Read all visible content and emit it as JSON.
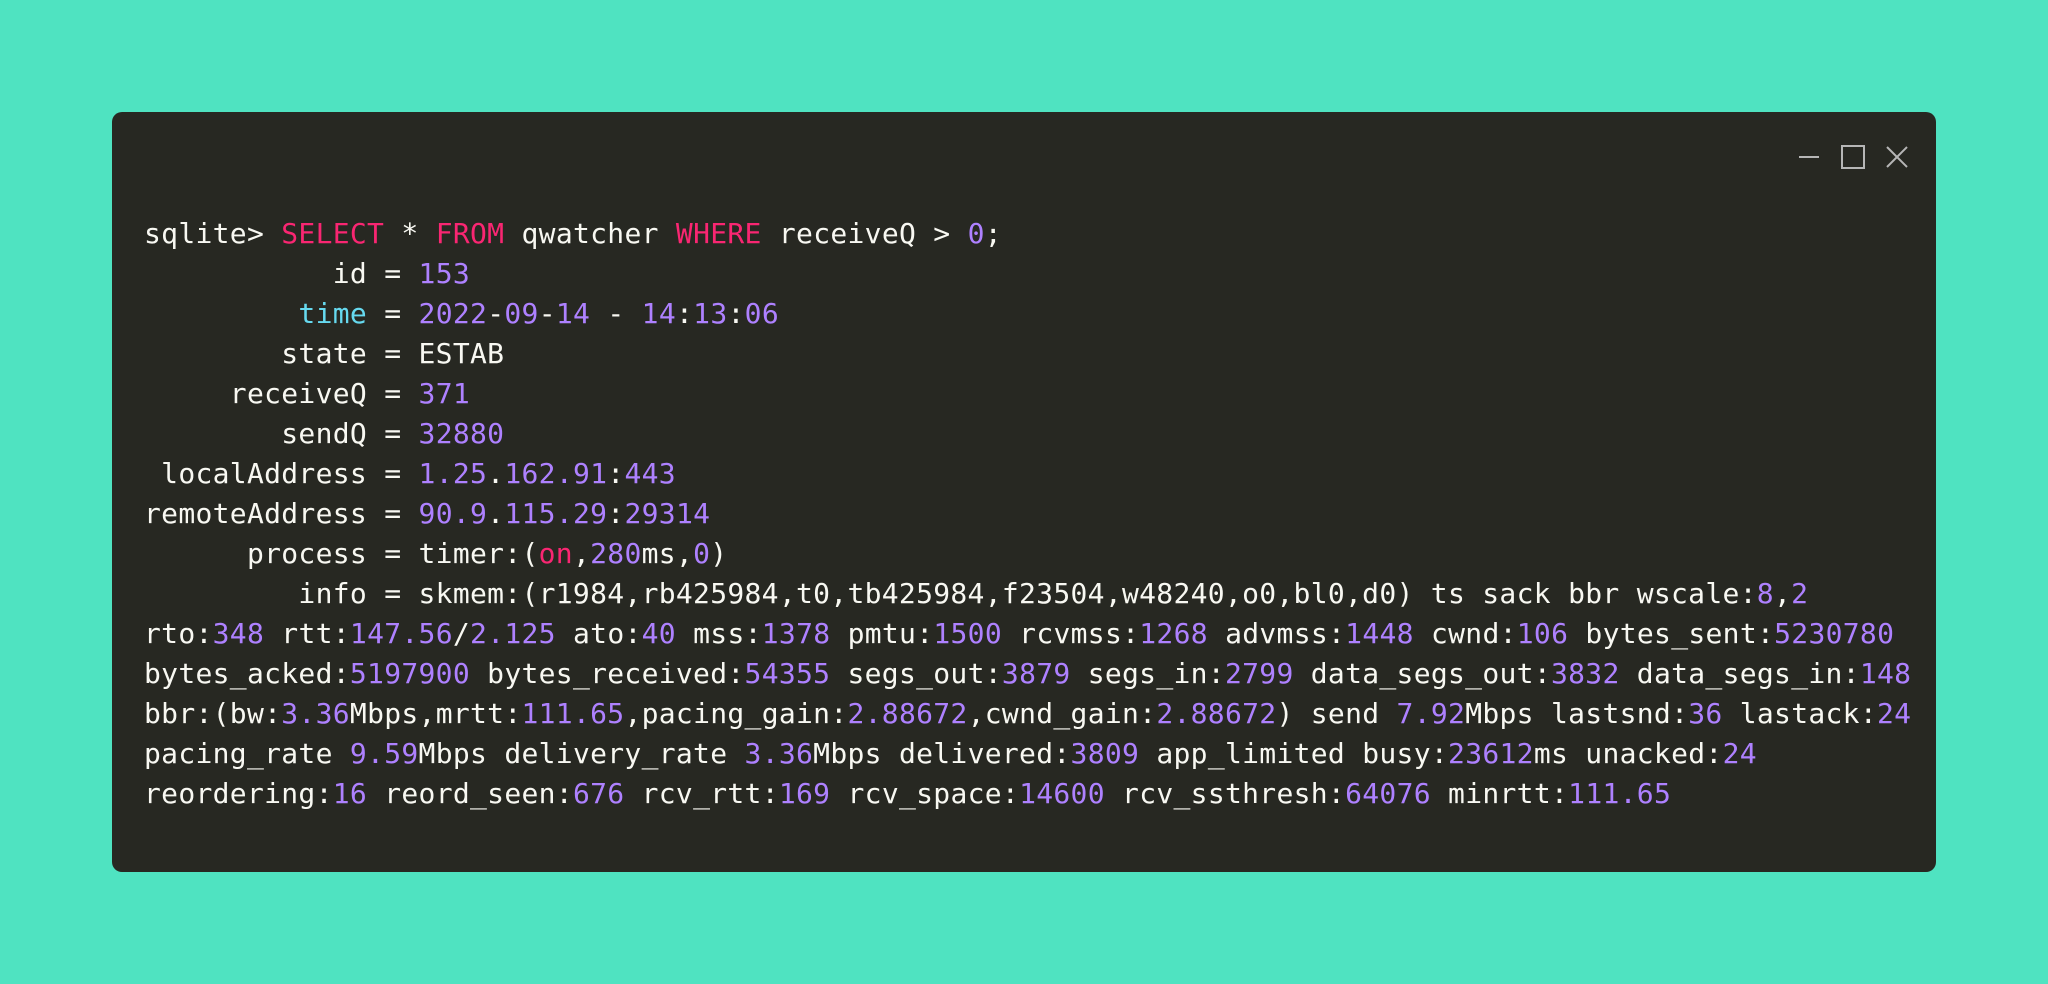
{
  "colors": {
    "background": "#4fe3c1",
    "window": "#272822",
    "text": "#f8f8f2",
    "keyword": "#f92672",
    "number": "#ae81ff",
    "highlight": "#66d9ef",
    "controls": "#b6b6b6"
  },
  "window_controls": [
    {
      "name": "minimize-icon"
    },
    {
      "name": "maximize-icon"
    },
    {
      "name": "close-icon"
    }
  ],
  "terminal_lines": [
    [
      [
        "t",
        "sqlite> "
      ],
      [
        "k",
        "SELECT"
      ],
      [
        "t",
        " * "
      ],
      [
        "k",
        "FROM"
      ],
      [
        "t",
        " qwatcher "
      ],
      [
        "k",
        "WHERE"
      ],
      [
        "t",
        " receiveQ > "
      ],
      [
        "n",
        "0"
      ],
      [
        "t",
        ";"
      ]
    ],
    [
      [
        "t",
        "           id = "
      ],
      [
        "n",
        "153"
      ]
    ],
    [
      [
        "t",
        "         "
      ],
      [
        "c",
        "time"
      ],
      [
        "t",
        " = "
      ],
      [
        "n",
        "2022"
      ],
      [
        "t",
        "-"
      ],
      [
        "n",
        "09"
      ],
      [
        "t",
        "-"
      ],
      [
        "n",
        "14"
      ],
      [
        "t",
        " - "
      ],
      [
        "n",
        "14"
      ],
      [
        "t",
        ":"
      ],
      [
        "n",
        "13"
      ],
      [
        "t",
        ":"
      ],
      [
        "n",
        "06"
      ]
    ],
    [
      [
        "t",
        "        state = ESTAB"
      ]
    ],
    [
      [
        "t",
        "     receiveQ = "
      ],
      [
        "n",
        "371"
      ]
    ],
    [
      [
        "t",
        "        sendQ = "
      ],
      [
        "n",
        "32880"
      ]
    ],
    [
      [
        "t",
        " localAddress = "
      ],
      [
        "n",
        "1.25"
      ],
      [
        "t",
        "."
      ],
      [
        "n",
        "162.91"
      ],
      [
        "t",
        ":"
      ],
      [
        "n",
        "443"
      ]
    ],
    [
      [
        "t",
        "remoteAddress = "
      ],
      [
        "n",
        "90.9"
      ],
      [
        "t",
        "."
      ],
      [
        "n",
        "115.29"
      ],
      [
        "t",
        ":"
      ],
      [
        "n",
        "29314"
      ]
    ],
    [
      [
        "t",
        "      process = timer:("
      ],
      [
        "k",
        "on"
      ],
      [
        "t",
        ","
      ],
      [
        "n",
        "280"
      ],
      [
        "t",
        "ms,"
      ],
      [
        "n",
        "0"
      ],
      [
        "t",
        ")"
      ]
    ],
    [
      [
        "t",
        "         info = skmem:(r1984,rb425984,t0,tb425984,f23504,w48240,o0,bl0,d0) ts sack bbr wscale:"
      ],
      [
        "n",
        "8"
      ],
      [
        "t",
        ","
      ],
      [
        "n",
        "2"
      ]
    ],
    [
      [
        "t",
        "rto:"
      ],
      [
        "n",
        "348"
      ],
      [
        "t",
        " rtt:"
      ],
      [
        "n",
        "147.56"
      ],
      [
        "t",
        "/"
      ],
      [
        "n",
        "2.125"
      ],
      [
        "t",
        " ato:"
      ],
      [
        "n",
        "40"
      ],
      [
        "t",
        " mss:"
      ],
      [
        "n",
        "1378"
      ],
      [
        "t",
        " pmtu:"
      ],
      [
        "n",
        "1500"
      ],
      [
        "t",
        " rcvmss:"
      ],
      [
        "n",
        "1268"
      ],
      [
        "t",
        " advmss:"
      ],
      [
        "n",
        "1448"
      ],
      [
        "t",
        " cwnd:"
      ],
      [
        "n",
        "106"
      ],
      [
        "t",
        " bytes_sent:"
      ],
      [
        "n",
        "5230780"
      ]
    ],
    [
      [
        "t",
        "bytes_acked:"
      ],
      [
        "n",
        "5197900"
      ],
      [
        "t",
        " bytes_received:"
      ],
      [
        "n",
        "54355"
      ],
      [
        "t",
        " segs_out:"
      ],
      [
        "n",
        "3879"
      ],
      [
        "t",
        " segs_in:"
      ],
      [
        "n",
        "2799"
      ],
      [
        "t",
        " data_segs_out:"
      ],
      [
        "n",
        "3832"
      ],
      [
        "t",
        " data_segs_in:"
      ],
      [
        "n",
        "148"
      ]
    ],
    [
      [
        "t",
        "bbr:(bw:"
      ],
      [
        "n",
        "3.36"
      ],
      [
        "t",
        "Mbps,mrtt:"
      ],
      [
        "n",
        "111.65"
      ],
      [
        "t",
        ",pacing_gain:"
      ],
      [
        "n",
        "2.88672"
      ],
      [
        "t",
        ",cwnd_gain:"
      ],
      [
        "n",
        "2.88672"
      ],
      [
        "t",
        ") send "
      ],
      [
        "n",
        "7.92"
      ],
      [
        "t",
        "Mbps lastsnd:"
      ],
      [
        "n",
        "36"
      ],
      [
        "t",
        " lastack:"
      ],
      [
        "n",
        "24"
      ]
    ],
    [
      [
        "t",
        "pacing_rate "
      ],
      [
        "n",
        "9.59"
      ],
      [
        "t",
        "Mbps delivery_rate "
      ],
      [
        "n",
        "3.36"
      ],
      [
        "t",
        "Mbps delivered:"
      ],
      [
        "n",
        "3809"
      ],
      [
        "t",
        " app_limited busy:"
      ],
      [
        "n",
        "23612"
      ],
      [
        "t",
        "ms unacked:"
      ],
      [
        "n",
        "24"
      ]
    ],
    [
      [
        "t",
        "reordering:"
      ],
      [
        "n",
        "16"
      ],
      [
        "t",
        " reord_seen:"
      ],
      [
        "n",
        "676"
      ],
      [
        "t",
        " rcv_rtt:"
      ],
      [
        "n",
        "169"
      ],
      [
        "t",
        " rcv_space:"
      ],
      [
        "n",
        "14600"
      ],
      [
        "t",
        " rcv_ssthresh:"
      ],
      [
        "n",
        "64076"
      ],
      [
        "t",
        " minrtt:"
      ],
      [
        "n",
        "111.65"
      ]
    ]
  ]
}
